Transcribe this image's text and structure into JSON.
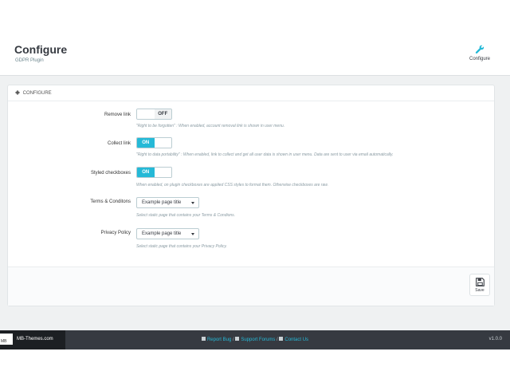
{
  "header": {
    "title": "Configure",
    "subtitle": "GDPR Plugin",
    "tool_label": "Configure",
    "tool_icon": "wrench-icon"
  },
  "panel": {
    "heading": "CONFIGURE",
    "heading_icon": "gear-icon",
    "fields": [
      {
        "label": "Remove link",
        "type": "switch",
        "value": "OFF",
        "help": "\"Right to be forgotten\" : When enabled, account removal link is shown in user menu."
      },
      {
        "label": "Collect link",
        "type": "switch",
        "value": "ON",
        "help": "\"Right to data portability\" : When enabled, link to collect and get all user data is shown in user menu. Data are sent to user via email automatically."
      },
      {
        "label": "Styled checkboxes",
        "type": "switch",
        "value": "ON",
        "help": "When enabled, on plugin checkboxes are applied CSS styles to format them. Otherwise checkboxes are raw."
      },
      {
        "label": "Terms & Conditons",
        "type": "select",
        "value": "Example page title",
        "help": "Select static page that contains your Terms & Condions."
      },
      {
        "label": "Privacy Policy",
        "type": "select",
        "value": "Example page title",
        "help": "Select static page that contains your Privacy Policy."
      }
    ],
    "save_label": "Save",
    "save_icon": "floppy-disk-icon"
  },
  "footer": {
    "logo_badge": "MB",
    "brand": "MB-Themes.com",
    "links": [
      {
        "label": "Report Bug",
        "icon": "bug-icon"
      },
      {
        "label": "Support Forums",
        "icon": "eye-icon"
      },
      {
        "label": "Contact Us",
        "icon": "envelope-icon"
      }
    ],
    "separator": "/",
    "version": "v1.0.0"
  },
  "colors": {
    "accent": "#25b9d7",
    "footer_bg": "#363a41",
    "page_bg": "#eff1f2"
  }
}
